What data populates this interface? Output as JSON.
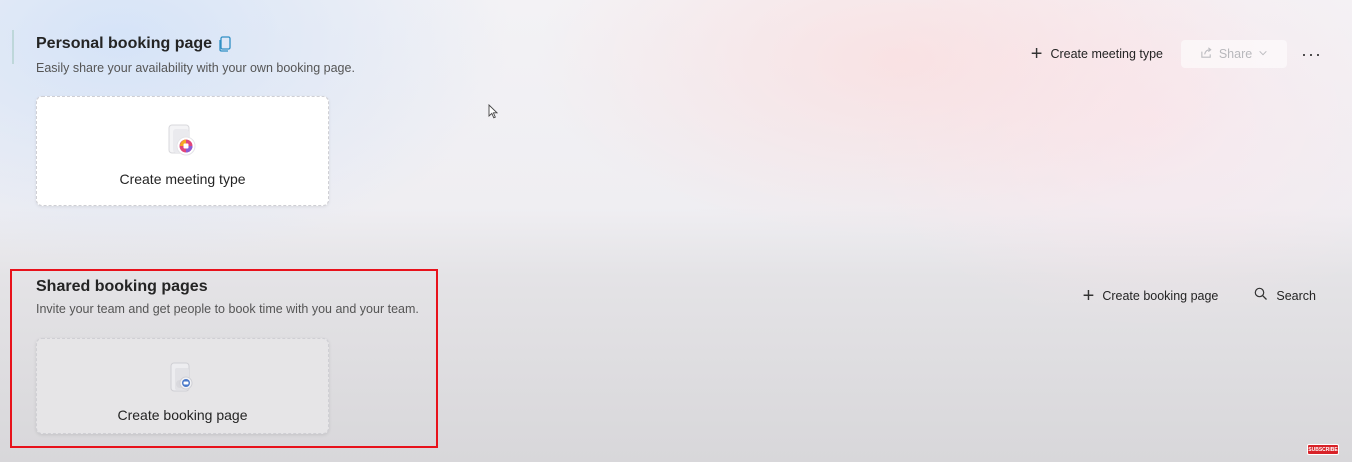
{
  "personal": {
    "title": "Personal booking page",
    "subtitle": "Easily share your availability with your own booking page.",
    "toolbar": {
      "create_meeting_type": "Create meeting type",
      "share": "Share",
      "more": "···"
    },
    "card": {
      "label": "Create meeting type"
    }
  },
  "shared": {
    "title": "Shared booking pages",
    "subtitle": "Invite your team and get people to book time with you and your team.",
    "toolbar": {
      "create_booking_page": "Create booking page",
      "search": "Search"
    },
    "card": {
      "label": "Create booking page"
    }
  },
  "overlay": {
    "subscribe_badge": "SUBSCRIBE",
    "highlight_color": "#e8121b"
  },
  "icons": [
    "copy-icon",
    "plus-icon",
    "share-icon",
    "chevron-down-icon",
    "more-icon",
    "search-icon",
    "meeting-type-icon",
    "booking-page-icon",
    "cursor-icon"
  ]
}
